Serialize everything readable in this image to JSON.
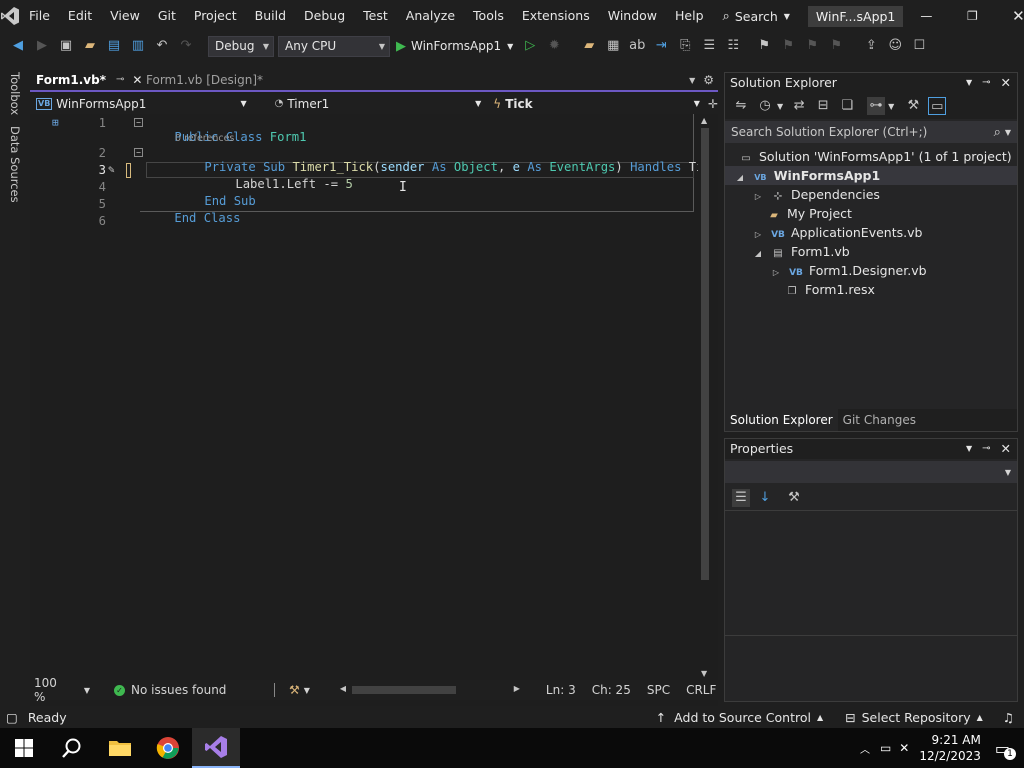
{
  "titlebar": {
    "menus": [
      "File",
      "Edit",
      "View",
      "Git",
      "Project",
      "Build",
      "Debug",
      "Test",
      "Analyze",
      "Tools",
      "Extensions",
      "Window",
      "Help"
    ],
    "search_label": "Search",
    "solution_badge": "WinF...sApp1"
  },
  "toolbar": {
    "config": "Debug",
    "platform": "Any CPU",
    "run_target": "WinFormsApp1"
  },
  "sidestrip": {
    "toolbox": "Toolbox",
    "data_sources": "Data Sources"
  },
  "tabs": [
    {
      "label": "Form1.vb*",
      "active": true
    },
    {
      "label": "Form1.vb [Design]*",
      "active": false
    }
  ],
  "nav": {
    "project": "WinFormsApp1",
    "object": "Timer1",
    "member": "Tick"
  },
  "code": {
    "line_numbers": [
      "1",
      "2",
      "3",
      "4",
      "5",
      "6"
    ],
    "codelens": "0 references",
    "line1": {
      "kw1": "Public",
      "kw2": "Class",
      "name": "Form1"
    },
    "line2": {
      "kw1": "Private",
      "kw2": "Sub",
      "fn": "Timer1_Tick",
      "open": "(",
      "p1": "sender",
      "as1": "As",
      "t1": "Object",
      "comma": ",",
      "p2": "e",
      "as2": "As",
      "t2": "EventArgs",
      "close": ")",
      "handles": "Handles",
      "rest": "Ti"
    },
    "line3": {
      "obj": "Label1",
      "prop": ".Left",
      "op": " -= ",
      "num": "5"
    },
    "line4": {
      "kw1": "End",
      "kw2": "Sub"
    },
    "line5": {
      "kw1": "End",
      "kw2": "Class"
    }
  },
  "editor_status": {
    "zoom": "100 %",
    "issues": "No issues found",
    "ln": "Ln: 3",
    "ch": "Ch: 25",
    "spc": "SPC",
    "crlf": "CRLF"
  },
  "solution_explorer": {
    "title": "Solution Explorer",
    "search_placeholder": "Search Solution Explorer (Ctrl+;)",
    "items": [
      {
        "label": "Solution 'WinFormsApp1' (1 of 1 project)",
        "icon": "solution-icon",
        "bold": false
      },
      {
        "label": "WinFormsApp1",
        "icon": "vb-project-icon",
        "bold": true
      },
      {
        "label": "Dependencies",
        "icon": "dependencies-icon"
      },
      {
        "label": "My Project",
        "icon": "wrench-folder-icon"
      },
      {
        "label": "ApplicationEvents.vb",
        "icon": "vb-file-icon"
      },
      {
        "label": "Form1.vb",
        "icon": "form-icon"
      },
      {
        "label": "Form1.Designer.vb",
        "icon": "vb-file-icon"
      },
      {
        "label": "Form1.resx",
        "icon": "resx-icon"
      }
    ],
    "tabs": [
      "Solution Explorer",
      "Git Changes"
    ]
  },
  "properties": {
    "title": "Properties"
  },
  "statusbar": {
    "ready": "Ready",
    "source_control": "Add to Source Control",
    "repo": "Select Repository"
  },
  "taskbar": {
    "time": "9:21 AM",
    "date": "12/2/2023",
    "notif_count": "1"
  },
  "colors": {
    "accent": "#6c58c3",
    "keyword": "#569cd6",
    "type": "#4ec9b0",
    "function": "#dcdcaa"
  }
}
